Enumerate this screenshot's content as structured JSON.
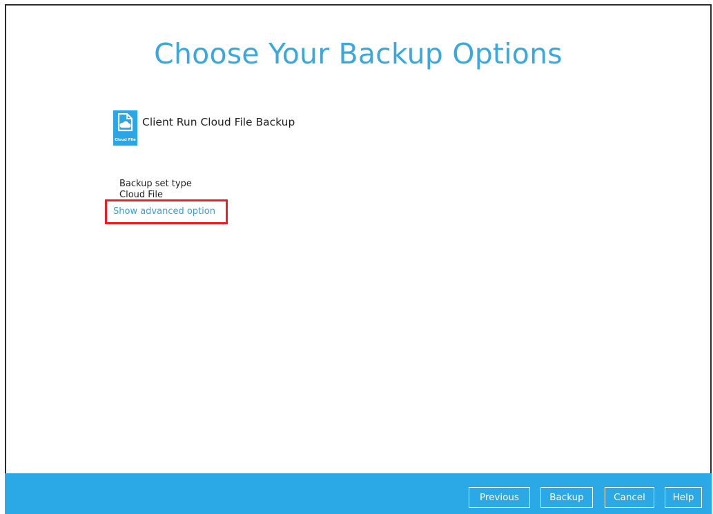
{
  "page": {
    "title": "Choose Your Backup Options"
  },
  "module": {
    "icon_label": "Cloud File",
    "title": "Client Run Cloud File Backup"
  },
  "backup_set": {
    "type_label": "Backup set type",
    "type_value": "Cloud File"
  },
  "advanced": {
    "link_label": "Show advanced option"
  },
  "footer": {
    "previous_label": "Previous",
    "backup_label": "Backup",
    "cancel_label": "Cancel",
    "help_label": "Help"
  },
  "colors": {
    "accent": "#2aa9e6",
    "title": "#3aa7dd",
    "highlight": "#ee1c24"
  }
}
